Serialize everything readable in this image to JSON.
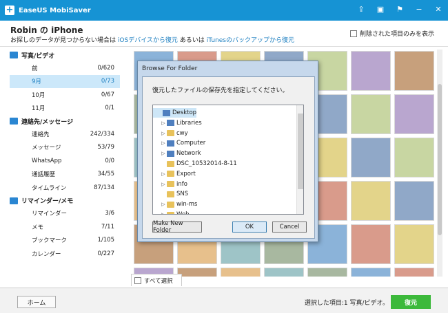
{
  "app": {
    "title": "EaseUS MobiSaver"
  },
  "header": {
    "device_title": "Robin の iPhone",
    "hint_prefix": "お探しのデータが見つからない場合は",
    "hint_link_ios": "iOSデバイスから復元",
    "hint_middle": "あるいは",
    "hint_link_itunes": "iTunesのバックアップから復元",
    "only_deleted_label": "削除された項目のみを表示"
  },
  "sidebar": {
    "sections": [
      {
        "label": "写真/ビデオ",
        "icon": "photo-icon",
        "items": [
          {
            "label": "前",
            "count": "0/620"
          },
          {
            "label": "9月",
            "count": "0/73",
            "selected": true
          },
          {
            "label": "10月",
            "count": "0/67"
          },
          {
            "label": "11月",
            "count": "0/1"
          }
        ]
      },
      {
        "label": "連絡先/メッセージ",
        "icon": "contacts-icon",
        "items": [
          {
            "label": "連絡先",
            "count": "242/334"
          },
          {
            "label": "メッセージ",
            "count": "53/79"
          },
          {
            "label": "WhatsApp",
            "count": "0/0"
          },
          {
            "label": "通話履歴",
            "count": "34/55"
          },
          {
            "label": "タイムライン",
            "count": "87/134"
          }
        ]
      },
      {
        "label": "リマインダー/メモ",
        "icon": "reminder-icon",
        "items": [
          {
            "label": "リマインダー",
            "count": "3/6"
          },
          {
            "label": "メモ",
            "count": "7/11"
          },
          {
            "label": "ブックマーク",
            "count": "1/105"
          },
          {
            "label": "カレンダー",
            "count": "0/227"
          }
        ]
      }
    ]
  },
  "grid": {
    "select_all_label": "すべて選択"
  },
  "footer": {
    "home_label": "ホーム",
    "status": "選択した項目:1 写真/ビデオ。",
    "recover_label": "復元"
  },
  "dialog": {
    "title": "Browse For Folder",
    "message": "復元したファイルの保存先を指定してください。",
    "tree": [
      {
        "label": "Desktop",
        "icon": "desktop-icon",
        "level": 0,
        "arrow": "",
        "selected": true
      },
      {
        "label": "Libraries",
        "icon": "library-icon",
        "level": 1,
        "arrow": "▷"
      },
      {
        "label": "cwy",
        "icon": "user-icon",
        "level": 1,
        "arrow": "▷"
      },
      {
        "label": "Computer",
        "icon": "computer-icon",
        "level": 1,
        "arrow": "▷"
      },
      {
        "label": "Network",
        "icon": "network-icon",
        "level": 1,
        "arrow": "▷"
      },
      {
        "label": "DSC_10532014-8-11",
        "icon": "folder-icon",
        "level": 1,
        "arrow": ""
      },
      {
        "label": "Export",
        "icon": "folder-icon",
        "level": 1,
        "arrow": "▷"
      },
      {
        "label": "info",
        "icon": "folder-icon",
        "level": 1,
        "arrow": "▷"
      },
      {
        "label": "SNS",
        "icon": "folder-icon",
        "level": 1,
        "arrow": ""
      },
      {
        "label": "win-ms",
        "icon": "folder-icon",
        "level": 1,
        "arrow": "▷"
      },
      {
        "label": "Web",
        "icon": "folder-icon",
        "level": 1,
        "arrow": "▷"
      }
    ],
    "make_new_folder_label": "Make New Folder",
    "ok_label": "OK",
    "cancel_label": "Cancel"
  },
  "colors": {
    "titlebar": "#1693d4",
    "link": "#1d7fc0",
    "recover": "#3cb93b",
    "selected_bg": "#cce8fa"
  }
}
